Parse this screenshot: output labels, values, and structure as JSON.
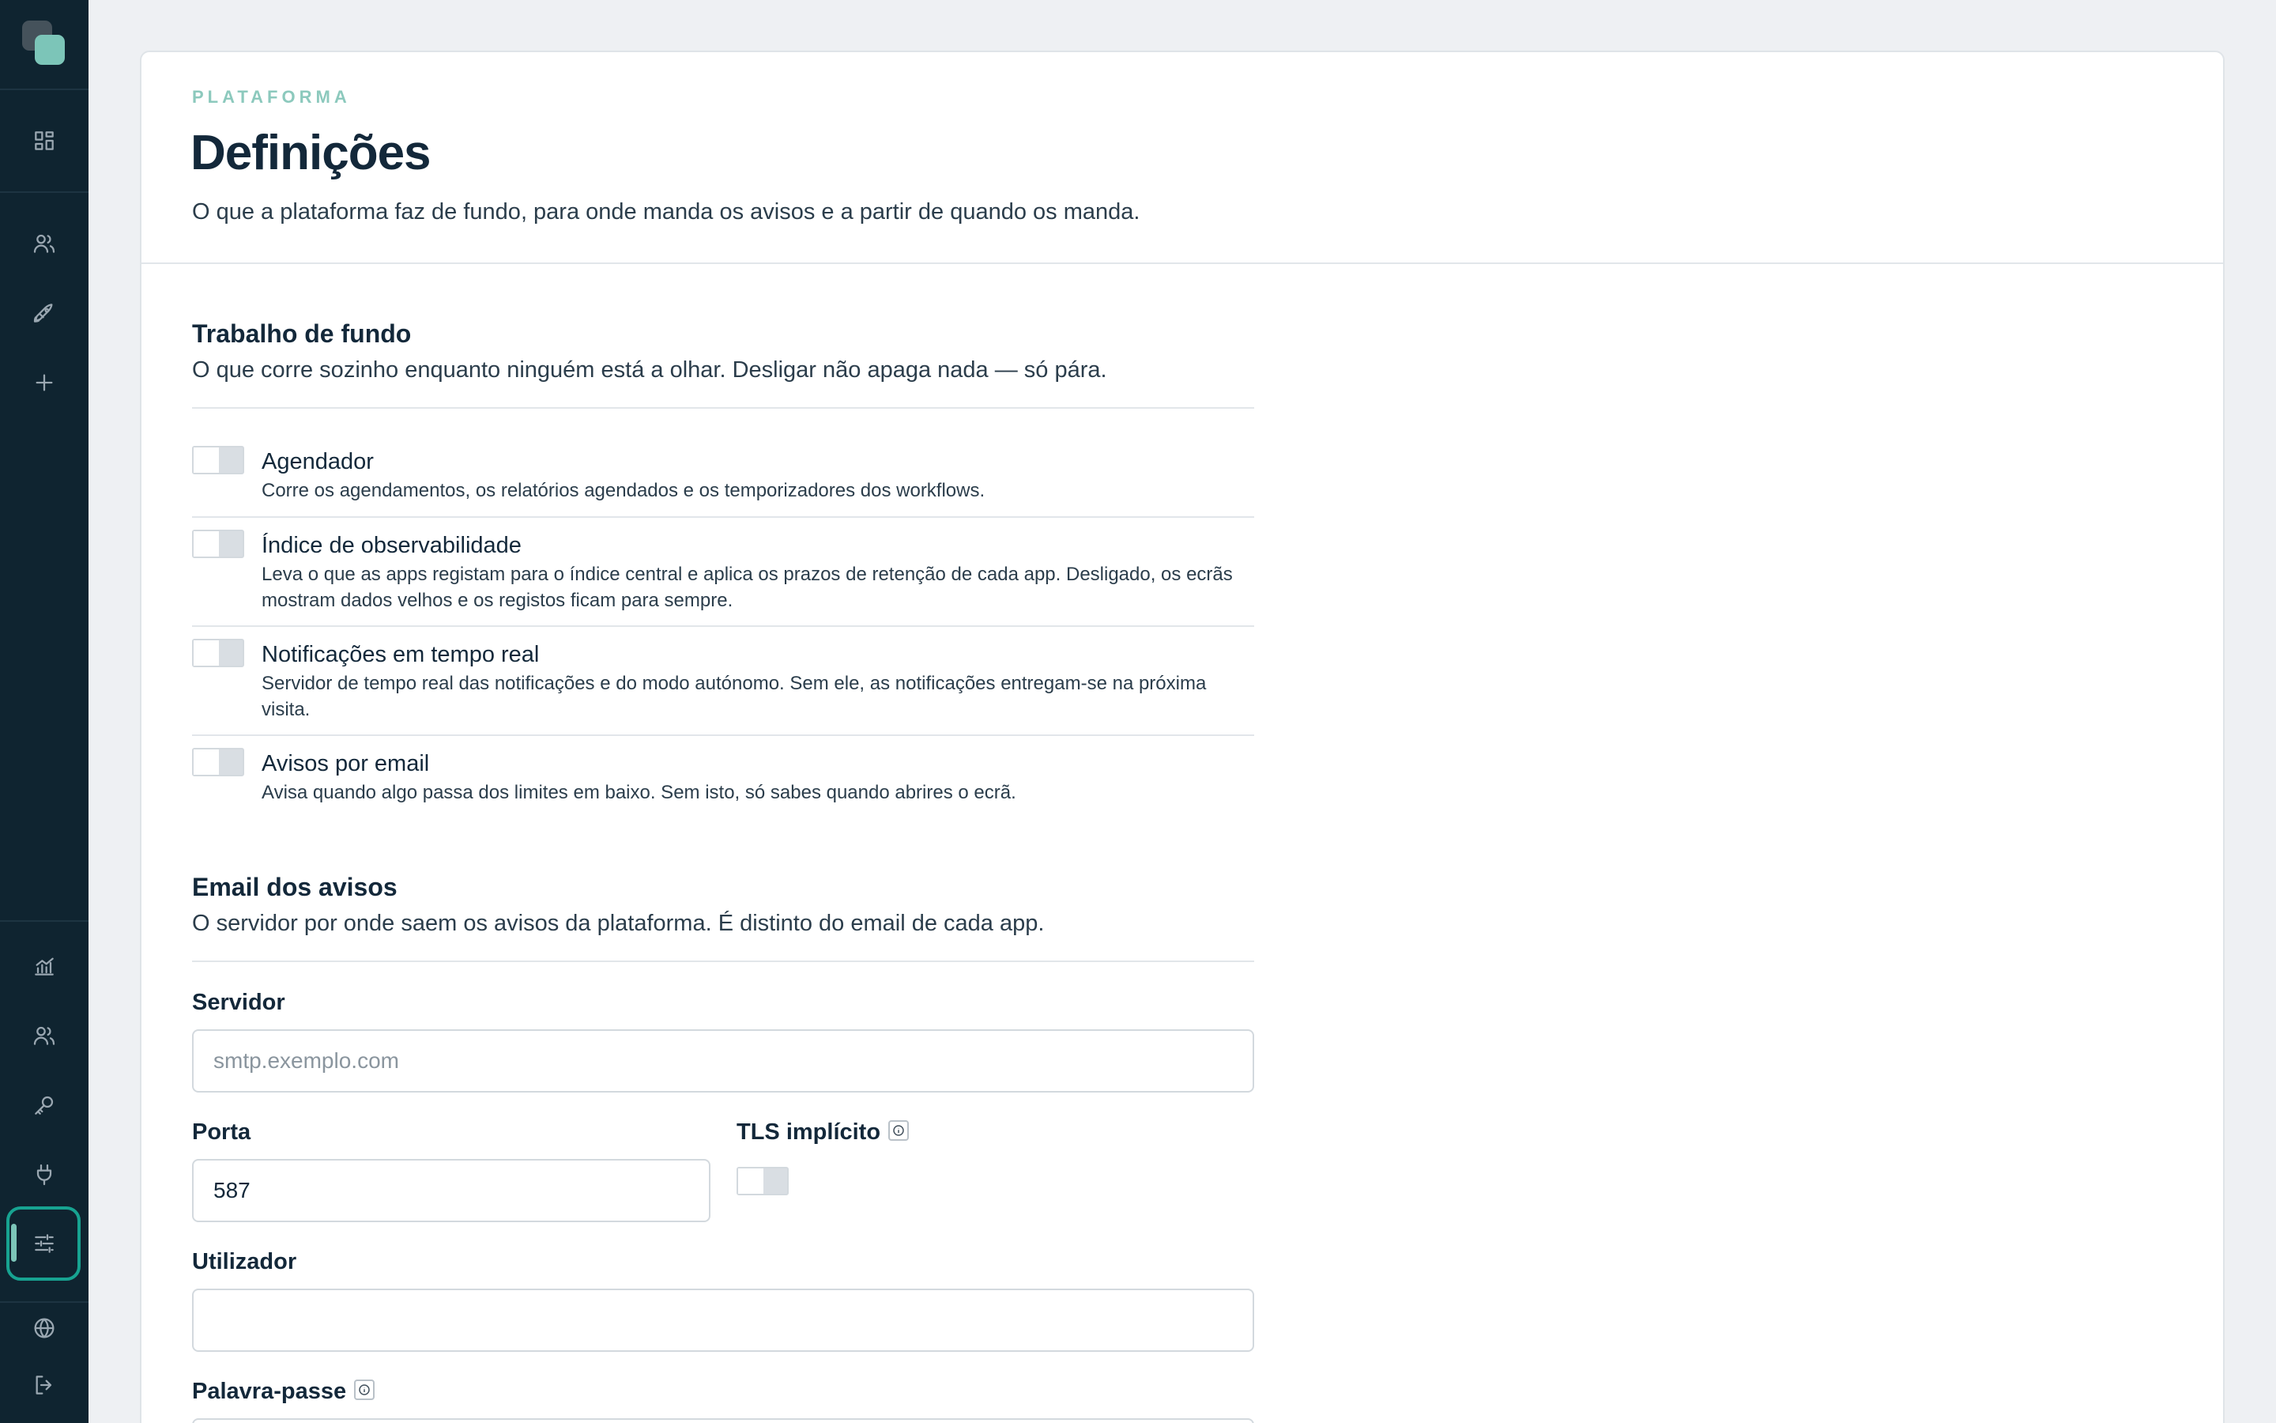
{
  "header": {
    "eyebrow": "PLATAFORMA",
    "title": "Definições",
    "subtitle": "O que a plataforma faz de fundo, para onde manda os avisos e a partir de quando os manda."
  },
  "background": {
    "title": "Trabalho de fundo",
    "description": "O que corre sozinho enquanto ninguém está a olhar. Desligar não apaga nada — só pára.",
    "options": [
      {
        "title": "Agendador",
        "description": "Corre os agendamentos, os relatórios agendados e os temporizadores dos workflows.",
        "enabled": false
      },
      {
        "title": "Índice de observabilidade",
        "description": "Leva o que as apps registam para o índice central e aplica os prazos de retenção de cada app. Desligado, os ecrãs mostram dados velhos e os registos ficam para sempre.",
        "enabled": false
      },
      {
        "title": "Notificações em tempo real",
        "description": "Servidor de tempo real das notificações e do modo autónomo. Sem ele, as notificações entregam-se na próxima visita.",
        "enabled": false
      },
      {
        "title": "Avisos por email",
        "description": "Avisa quando algo passa dos limites em baixo. Sem isto, só sabes quando abrires o ecrã.",
        "enabled": false
      }
    ]
  },
  "email": {
    "title": "Email dos avisos",
    "description": "O servidor por onde saem os avisos da plataforma. É distinto do email de cada app.",
    "server_label": "Servidor",
    "server_placeholder": "smtp.exemplo.com",
    "server_value": "",
    "port_label": "Porta",
    "port_value": "587",
    "tls_label": "TLS implícito",
    "tls_enabled": false,
    "user_label": "Utilizador",
    "user_value": "",
    "password_label": "Palavra-passe"
  },
  "sidebar": {
    "icons": [
      "dashboard-icon",
      "users-icon",
      "rocket-icon",
      "plus-icon",
      "analytics-icon",
      "team-icon",
      "key-icon",
      "plug-icon",
      "settings-sliders-icon",
      "globe-icon",
      "logout-icon"
    ],
    "active": "settings-sliders-icon"
  },
  "colors": {
    "sidebar_bg": "#0f2430",
    "accent": "#17a391",
    "eyebrow": "#8cc9bd"
  }
}
